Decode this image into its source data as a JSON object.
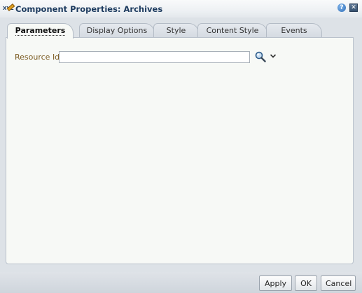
{
  "window": {
    "title": "Component Properties: Archives",
    "title_icon": "pencil-edit-icon",
    "help_icon": "?",
    "close_icon": "✕"
  },
  "tabs": [
    {
      "label": "Parameters",
      "active": true
    },
    {
      "label": "Display Options",
      "active": false
    },
    {
      "label": "Style",
      "active": false
    },
    {
      "label": "Content Style",
      "active": false
    },
    {
      "label": "Events",
      "active": false
    }
  ],
  "parameters": {
    "resource_id": {
      "label": "Resource Id",
      "value": "",
      "placeholder": ""
    }
  },
  "footer": {
    "apply_label": "Apply",
    "ok_label": "OK",
    "cancel_label": "Cancel"
  },
  "colors": {
    "title_text": "#1c3a5e",
    "label_text": "#7a5a20",
    "panel_bg": "#f7f9f6",
    "dialog_bg": "#dde2e7"
  }
}
